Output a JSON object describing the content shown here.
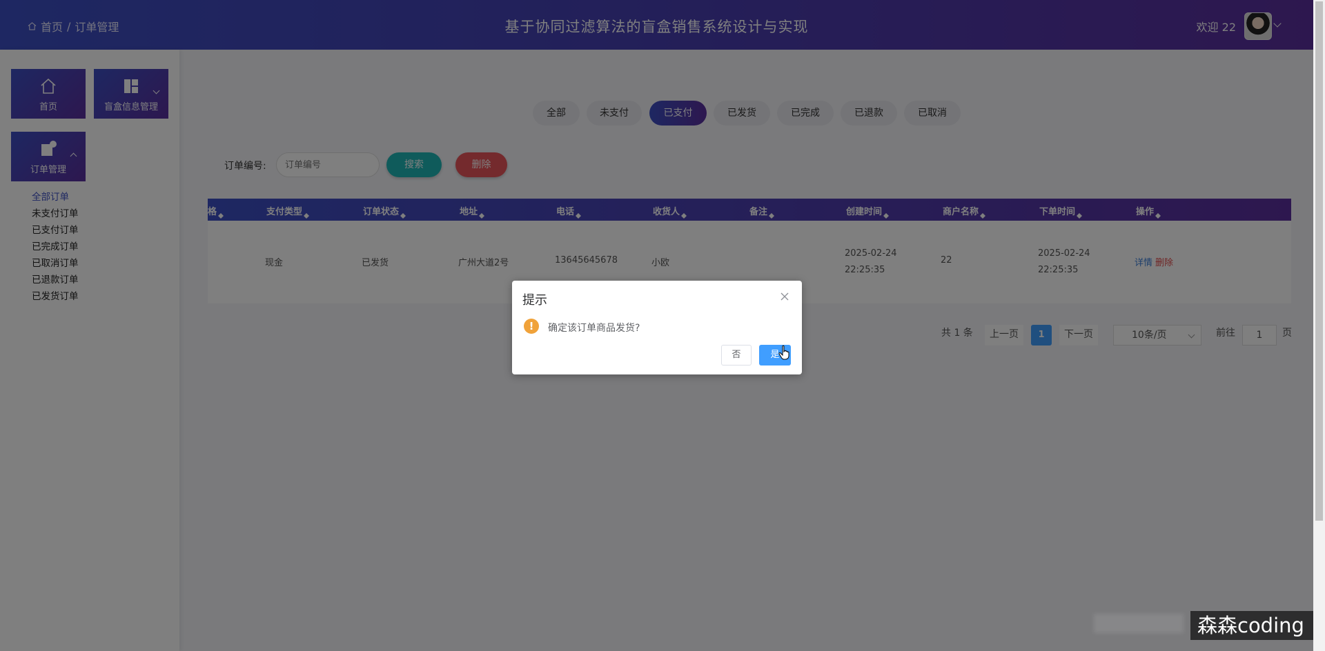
{
  "header": {
    "breadcrumb_home": "首页",
    "breadcrumb_sep": "/",
    "breadcrumb_current": "订单管理",
    "system_title": "基于协同过滤算法的盲盒销售系统设计与实现",
    "welcome": "欢迎 22"
  },
  "sidebar": {
    "home_label": "首页",
    "blindbox_label": "盲盒信息管理",
    "order_label": "订单管理",
    "submenu": [
      "全部订单",
      "未支付订单",
      "已支付订单",
      "已完成订单",
      "已取消订单",
      "已退款订单",
      "已发货订单"
    ]
  },
  "filters": [
    "全部",
    "未支付",
    "已支付",
    "已发货",
    "已完成",
    "已退款",
    "已取消"
  ],
  "active_filter": "已支付",
  "search": {
    "label": "订单编号:",
    "placeholder": "订单编号",
    "search_button": "搜索",
    "delete_button": "删除"
  },
  "table": {
    "columns": [
      "格",
      "支付类型",
      "订单状态",
      "地址",
      "电话",
      "收货人",
      "备注",
      "创建时间",
      "商户名称",
      "下单时间",
      "操作"
    ],
    "rows": [
      {
        "pay_type": "现金",
        "status": "已发货",
        "address": "广州大道2号",
        "phone": "13645645678",
        "receiver": "小欧",
        "remark": "",
        "created": "2025-02-24 22:25:35",
        "merchant": "22",
        "ordered": "2025-02-24 22:25:35",
        "detail": "详情",
        "delete": "删除"
      }
    ]
  },
  "pagination": {
    "total": "共 1 条",
    "prev": "上一页",
    "current": "1",
    "next": "下一页",
    "page_size": "10条/页",
    "goto_label": "前往",
    "goto_value": "1",
    "page_suffix": "页"
  },
  "dialog": {
    "title": "提示",
    "message": "确定该订单商品发货?",
    "cancel": "否",
    "confirm": "是"
  },
  "watermark": "森森coding",
  "colors": {
    "primary_gradient_start": "#3c4fc4",
    "primary_gradient_end": "#5b2f9e",
    "search_button": "#1fb6b6",
    "delete_button": "#e8555a",
    "dialog_confirm": "#409eff",
    "warning": "#f0a23a"
  }
}
